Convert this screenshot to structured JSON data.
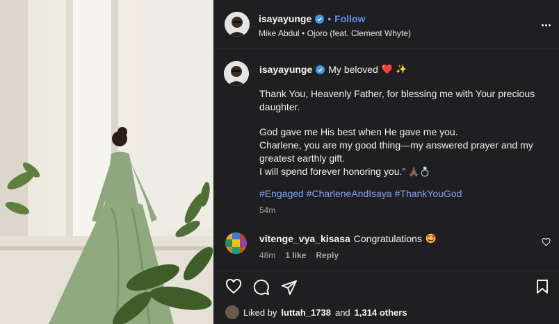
{
  "post": {
    "username": "isayayunge",
    "follow_label": "Follow",
    "separator": "•",
    "audio_artist": "Mike Abdul",
    "audio_track": "Ojoro (feat. Clement Whyte)"
  },
  "caption": {
    "username": "isayayunge",
    "headline": "My beloved",
    "headline_emojis": "❤️ ✨",
    "paragraph1": "Thank You, Heavenly Father, for blessing me with Your precious daughter.",
    "paragraph2_line1": "God gave me His best when He gave me you.",
    "paragraph2_line2": "Charlene, you are my good thing—my answered prayer and my greatest earthly gift.",
    "paragraph2_line3": "I will spend forever honoring you.”",
    "paragraph2_emojis": "🙏🏾💍",
    "hashtags": [
      "#Engaged",
      "#CharleneAndIsaya",
      "#ThankYouGod"
    ],
    "time": "54m"
  },
  "comment": {
    "username": "vitenge_vya_kisasa",
    "text": "Congratulations",
    "emoji": "🤩",
    "time": "48m",
    "likes": "1 like",
    "reply_label": "Reply"
  },
  "likes_summary": {
    "prefix": "Liked by",
    "user": "luttah_1738",
    "middle": "and",
    "others": "1,314 others"
  },
  "colors": {
    "panel_bg": "#1f1f21",
    "link_blue": "#5b8def",
    "hashtag_blue": "#7fa2f0",
    "verified_blue": "#3897f0",
    "dress_green": "#8fa77e"
  },
  "icons": [
    "verified-icon",
    "more-options-icon",
    "heart-icon",
    "comment-icon",
    "share-icon",
    "bookmark-icon",
    "small-heart-icon"
  ]
}
